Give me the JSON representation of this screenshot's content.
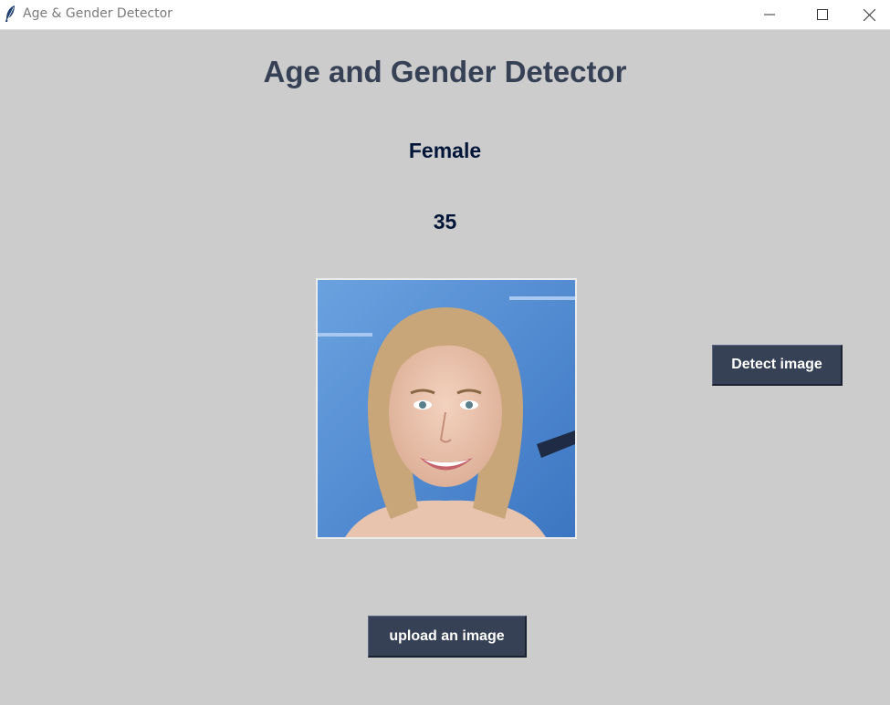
{
  "window": {
    "title": "Age & Gender Detector",
    "icon": "feather-icon",
    "controls": [
      "minimize-icon",
      "maximize-icon",
      "close-icon"
    ]
  },
  "heading": "Age and Gender Detector",
  "result": {
    "gender": "Female",
    "age": "35"
  },
  "image": {
    "description_icon": "uploaded-face-photo"
  },
  "buttons": {
    "detect": "Detect image",
    "upload": "upload an image"
  },
  "colors": {
    "background": "#cccccc",
    "heading": "#364156",
    "result_text": "#011638",
    "button_bg": "#364156",
    "button_text": "#ffffff"
  }
}
